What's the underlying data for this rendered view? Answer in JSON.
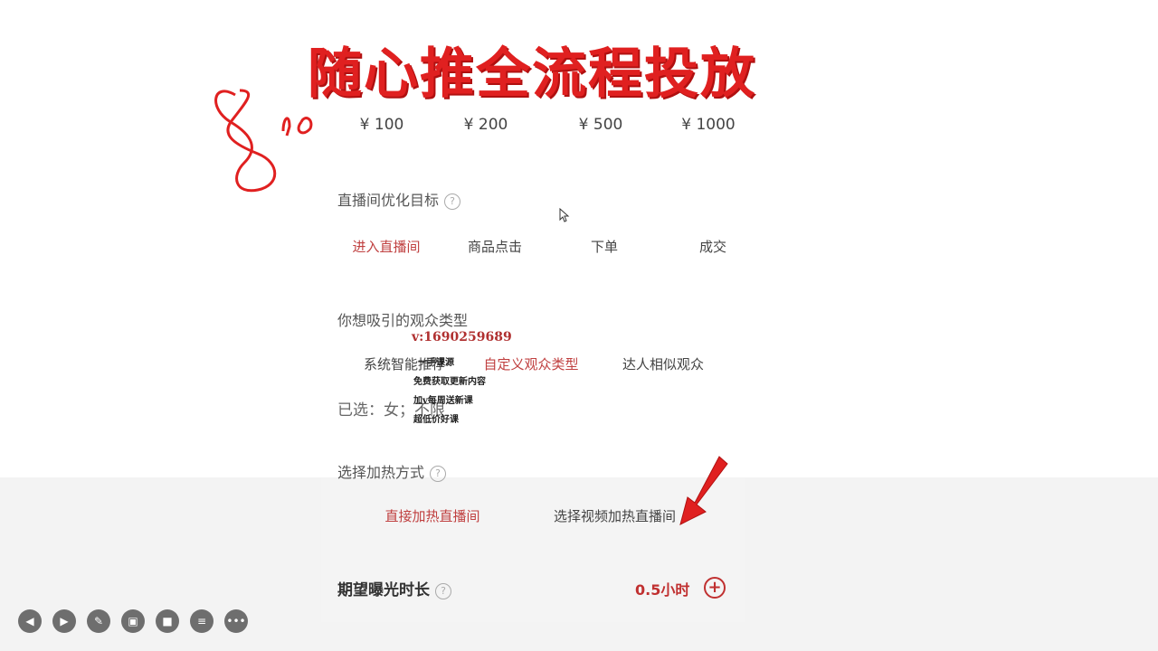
{
  "title": "随心推全流程投放",
  "handwritten": "8~10",
  "amounts": [
    "¥ 100",
    "¥ 200",
    "¥ 500",
    "¥ 1000"
  ],
  "goal": {
    "label": "直播间优化目标",
    "options": [
      "进入直播间",
      "商品点击",
      "下单",
      "成交"
    ],
    "selected": "进入直播间"
  },
  "audience": {
    "label": "你想吸引的观众类型",
    "options": [
      "系统智能推荐",
      "自定义观众类型",
      "达人相似观众"
    ],
    "selected": "自定义观众类型",
    "chosen_text": "已选：女；不限"
  },
  "watermark": {
    "contact": "v:1690259689",
    "lines": [
      "一手课源",
      "免费获取更新内容",
      "加v每周送新课",
      "超低价好课"
    ]
  },
  "heat": {
    "label": "选择加热方式",
    "options": [
      "直接加热直播间",
      "选择视频加热直播间"
    ],
    "selected": "直接加热直播间"
  },
  "duration": {
    "label": "期望曝光时长",
    "value": "0.5小时"
  },
  "colors": {
    "accent": "#c04040",
    "title": "#e02020",
    "arrow": "#e02020"
  },
  "toolbar_icons": [
    "prev-icon",
    "play-icon",
    "pen-icon",
    "screenshot-icon",
    "camera-icon",
    "chat-icon",
    "more-icon"
  ]
}
